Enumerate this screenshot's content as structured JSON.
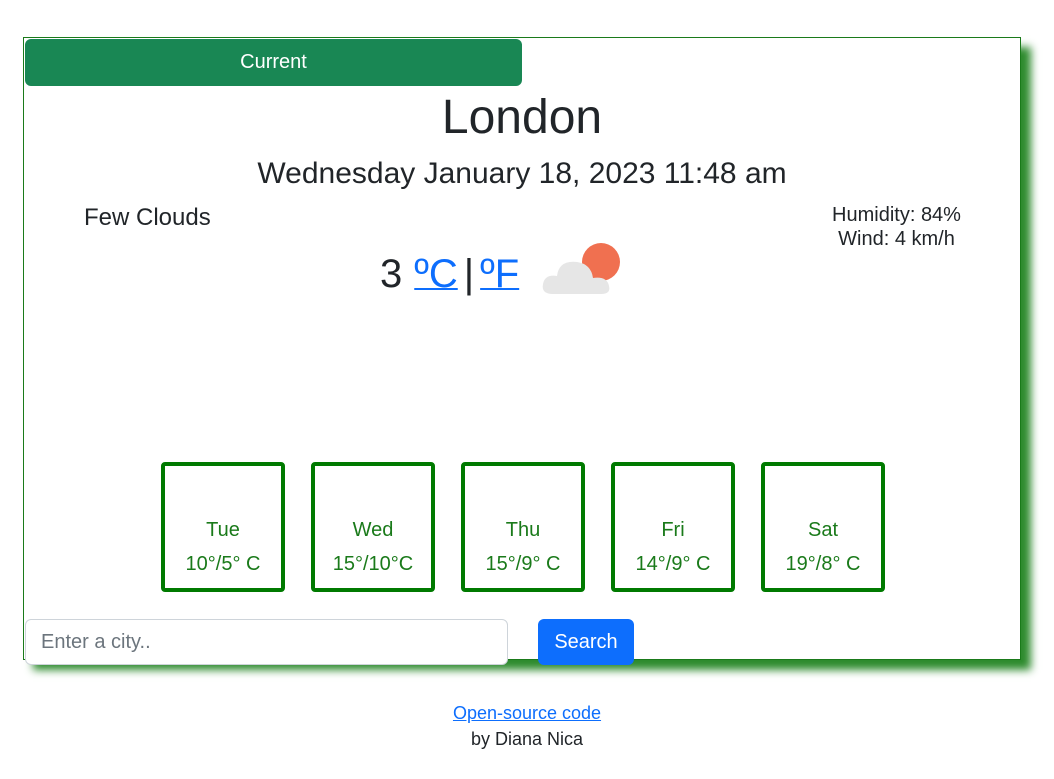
{
  "tabs": {
    "current_label": "Current"
  },
  "location": {
    "city": "London"
  },
  "datetime": "Wednesday January 18, 2023 11:48 am",
  "conditions": {
    "description": "Few Clouds",
    "humidity": "Humidity: 84%",
    "wind": "Wind: 4 km/h",
    "icon": "sun-behind-cloud-icon"
  },
  "temperature": {
    "value": "3",
    "celsius_label": "ºC",
    "separator": "|",
    "fahrenheit_label": "ºF"
  },
  "forecast": [
    {
      "day": "Tue",
      "temp": "10°/5° C"
    },
    {
      "day": "Wed",
      "temp": "15°/10°C"
    },
    {
      "day": "Thu",
      "temp": "15°/9° C"
    },
    {
      "day": "Fri",
      "temp": "14°/9° C"
    },
    {
      "day": "Sat",
      "temp": "19°/8° C"
    }
  ],
  "search": {
    "placeholder": "Enter a city..",
    "value": "",
    "button_label": "Search"
  },
  "footer": {
    "link_label": "Open-source code",
    "author": "by Diana Nica"
  },
  "colors": {
    "accent_green": "#198754",
    "forecast_border": "#007a00",
    "link_blue": "#0d6efd",
    "card_shadow": "#2e8b2e",
    "sun": "#f07050",
    "cloud": "#e6e6e6"
  }
}
